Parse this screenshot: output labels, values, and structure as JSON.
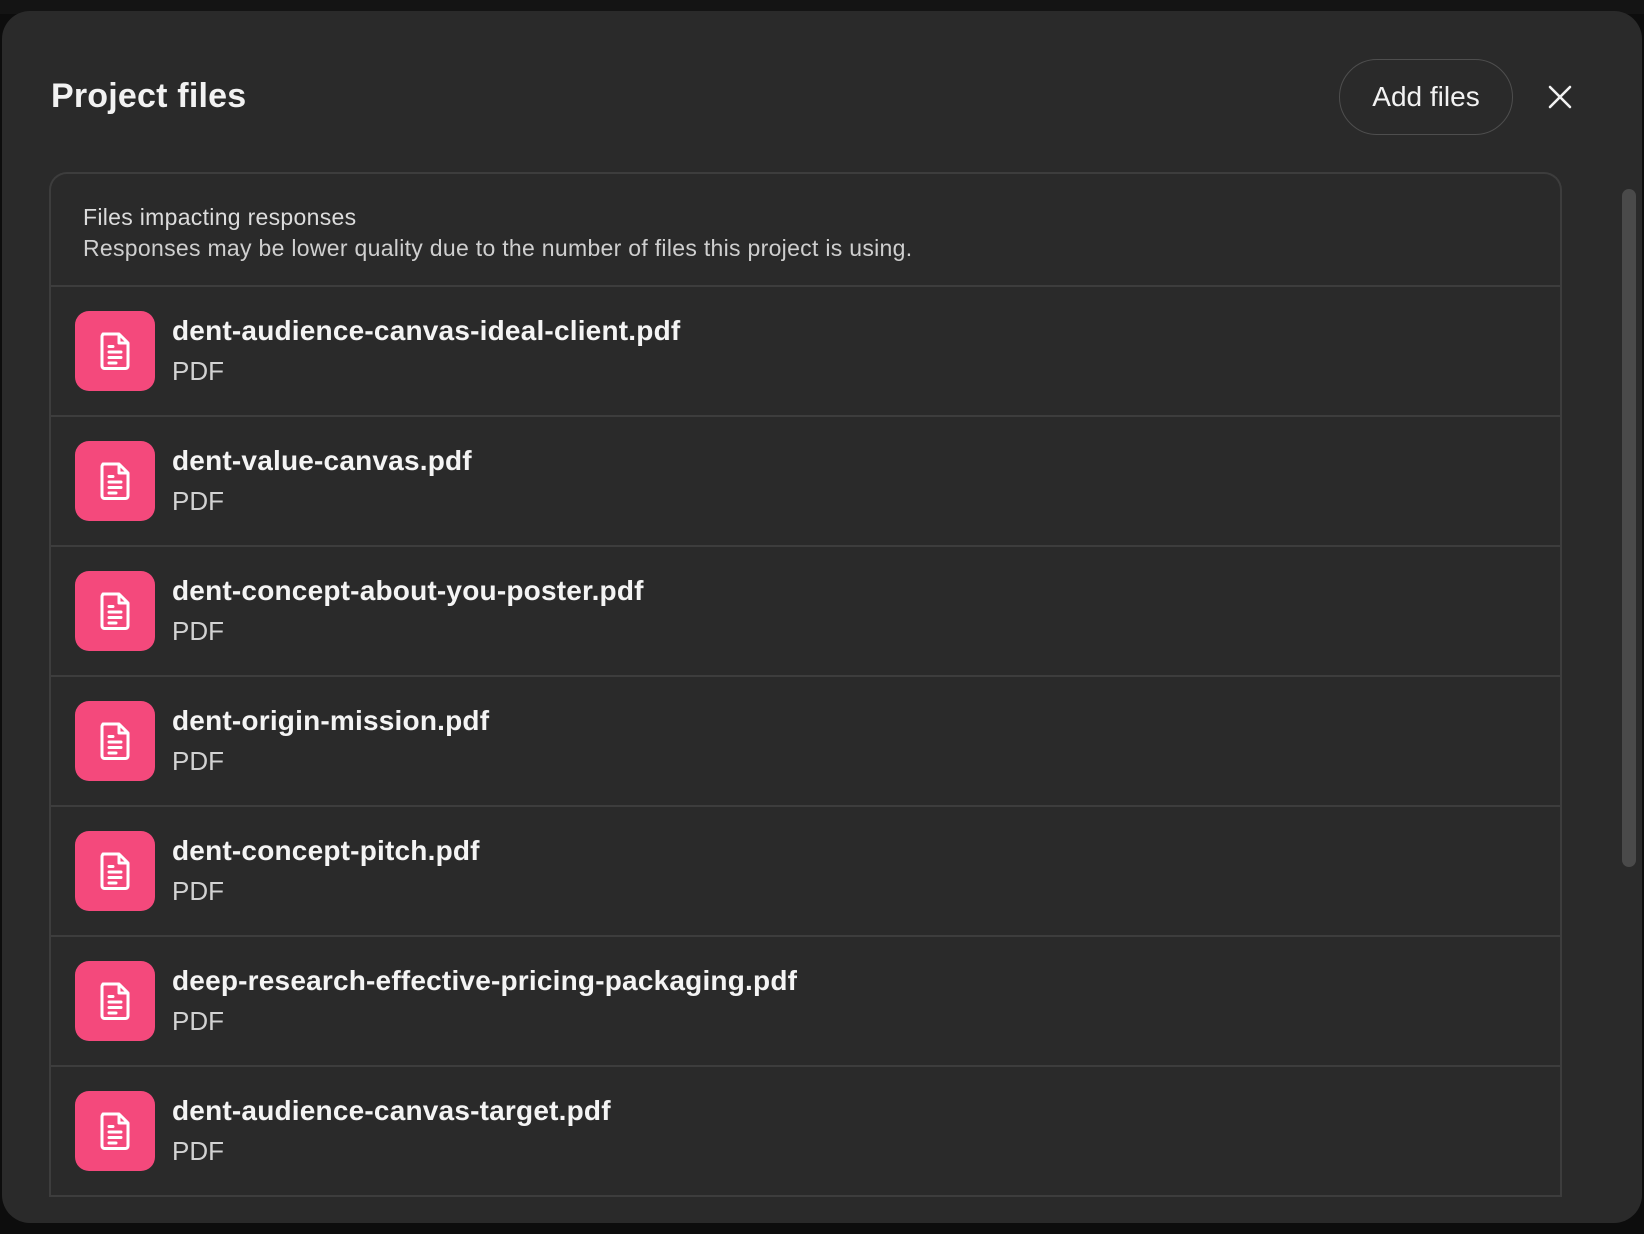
{
  "modal": {
    "title": "Project files",
    "add_files_label": "Add files"
  },
  "notice": {
    "title": "Files impacting responses",
    "body": "Responses may be lower quality due to the number of files this project is using."
  },
  "files": [
    {
      "name": "dent-audience-canvas-ideal-client.pdf",
      "type": "PDF"
    },
    {
      "name": "dent-value-canvas.pdf",
      "type": "PDF"
    },
    {
      "name": "dent-concept-about-you-poster.pdf",
      "type": "PDF"
    },
    {
      "name": "dent-origin-mission.pdf",
      "type": "PDF"
    },
    {
      "name": "dent-concept-pitch.pdf",
      "type": "PDF"
    },
    {
      "name": "deep-research-effective-pricing-packaging.pdf",
      "type": "PDF"
    },
    {
      "name": "dent-audience-canvas-target.pdf",
      "type": "PDF"
    }
  ],
  "icons": {
    "file": "document-icon",
    "close": "close-icon"
  },
  "colors": {
    "file_icon_bg": "#f4497c",
    "modal_bg": "#2a2a2a"
  }
}
